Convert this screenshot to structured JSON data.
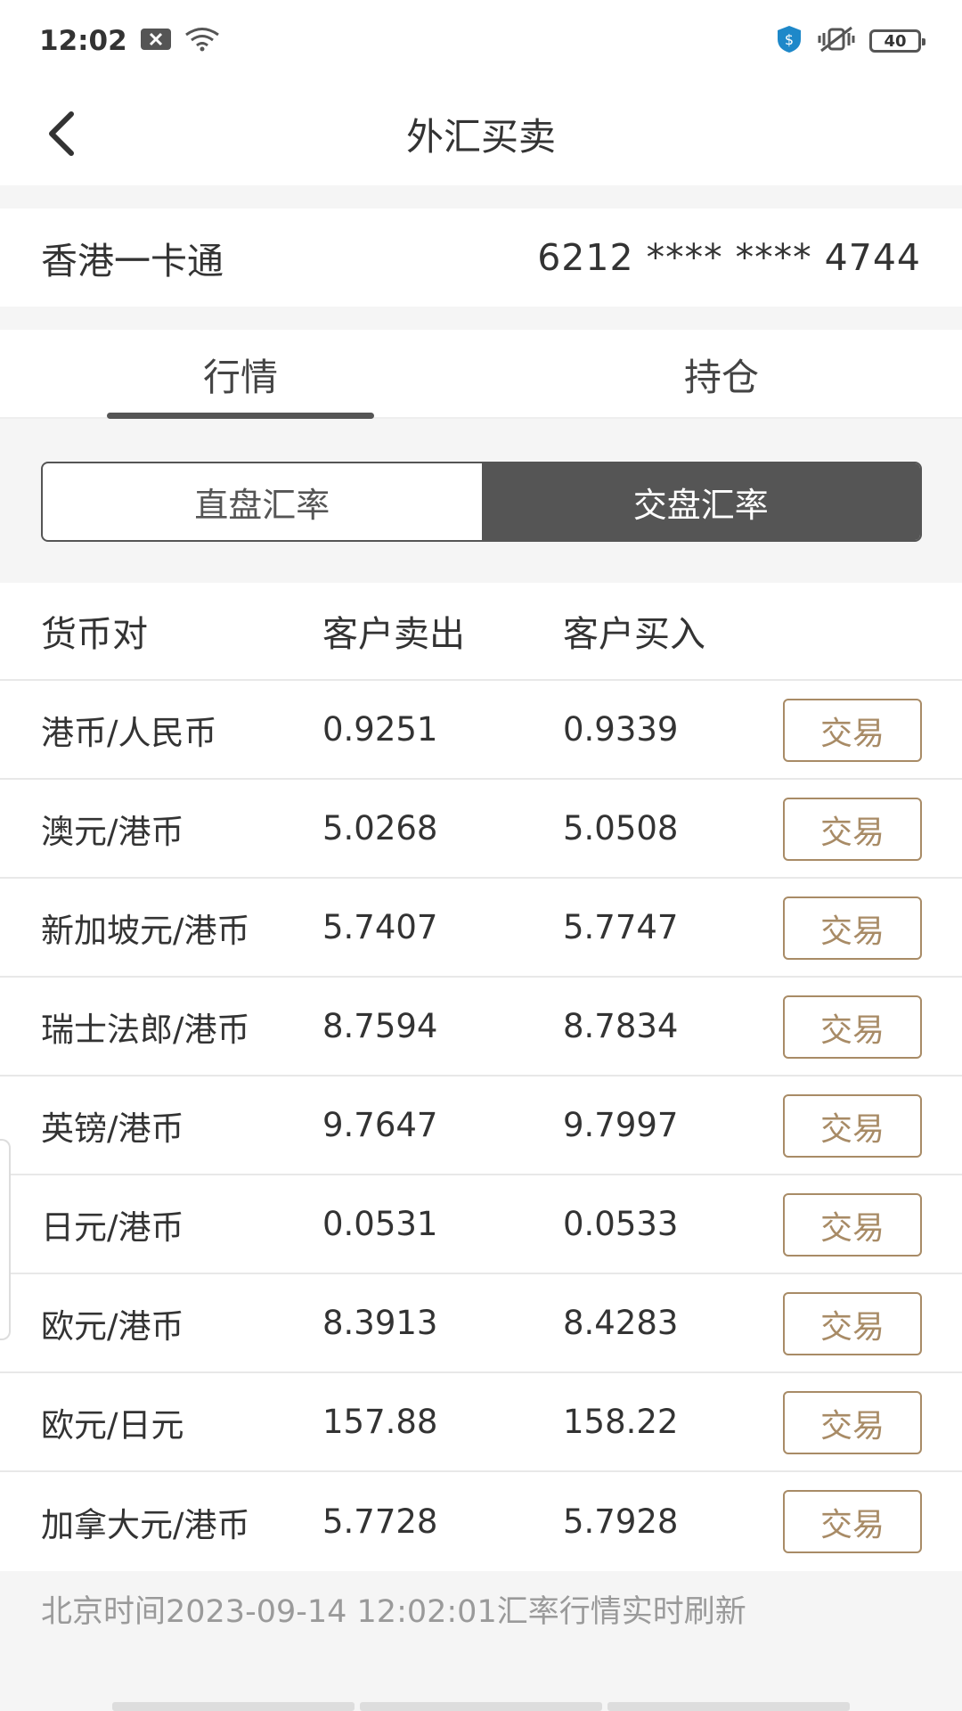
{
  "status_bar": {
    "time": "12:02",
    "battery": "40",
    "icons": [
      "notification-x-icon",
      "wifi-icon",
      "shield-icon",
      "vibrate-icon",
      "battery-icon"
    ]
  },
  "nav": {
    "title": "外汇买卖",
    "back_icon": "chevron-left-icon"
  },
  "card": {
    "name": "香港一卡通",
    "number": "6212 **** **** 4744"
  },
  "tabs": [
    {
      "label": "行情",
      "active": true
    },
    {
      "label": "持仓",
      "active": false
    }
  ],
  "segment": [
    {
      "label": "直盘汇率",
      "active": false
    },
    {
      "label": "交盘汇率",
      "active": true
    }
  ],
  "table": {
    "headers": {
      "pair": "货币对",
      "sell": "客户卖出",
      "buy": "客户买入"
    },
    "rows": [
      {
        "pair": "港币/人民币",
        "sell": "0.9251",
        "buy": "0.9339",
        "action": "交易"
      },
      {
        "pair": "澳元/港币",
        "sell": "5.0268",
        "buy": "5.0508",
        "action": "交易"
      },
      {
        "pair": "新加坡元/港币",
        "sell": "5.7407",
        "buy": "5.7747",
        "action": "交易"
      },
      {
        "pair": "瑞士法郎/港币",
        "sell": "8.7594",
        "buy": "8.7834",
        "action": "交易"
      },
      {
        "pair": "英镑/港币",
        "sell": "9.7647",
        "buy": "9.7997",
        "action": "交易"
      },
      {
        "pair": "日元/港币",
        "sell": "0.0531",
        "buy": "0.0533",
        "action": "交易"
      },
      {
        "pair": "欧元/港币",
        "sell": "8.3913",
        "buy": "8.4283",
        "action": "交易"
      },
      {
        "pair": "欧元/日元",
        "sell": "157.88",
        "buy": "158.22",
        "action": "交易"
      },
      {
        "pair": "加拿大元/港币",
        "sell": "5.7728",
        "buy": "5.7928",
        "action": "交易"
      }
    ]
  },
  "footer": {
    "note": "北京时间2023-09-14 12:02:01汇率行情实时刷新"
  },
  "colors": {
    "accent": "#a88b66",
    "segment_active": "#555555"
  }
}
